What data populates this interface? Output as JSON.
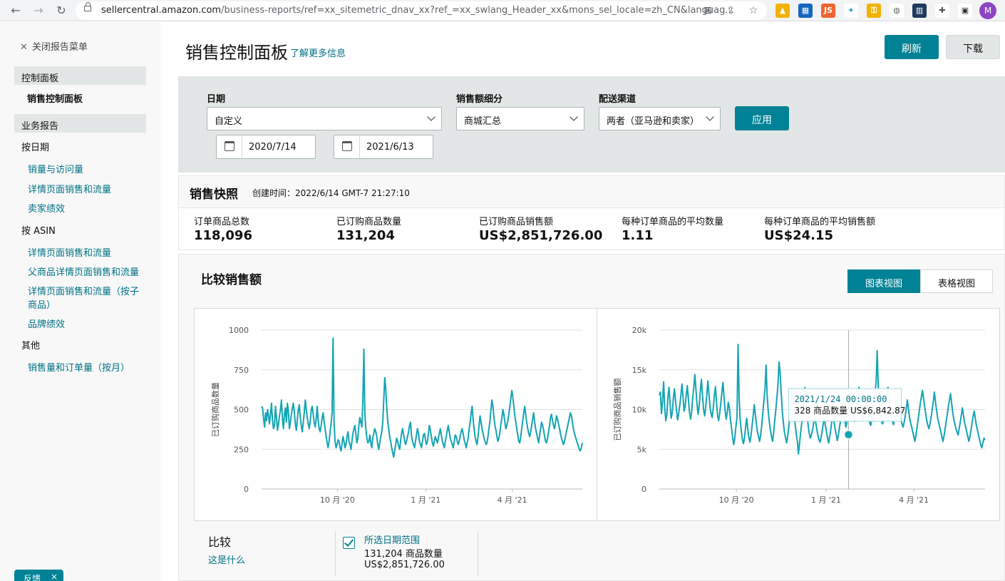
{
  "browser": {
    "url_host": "sellercentral.amazon.com",
    "url_path": "/business-reports/ref=xx_sitemetric_dnav_xx?ref_=xx_swlang_Header_xx&mons_sel_locale=zh_CN&languag...",
    "avatar_letter": "M",
    "nav_icons": [
      "back-icon",
      "forward-icon",
      "reload-icon"
    ]
  },
  "sidebar": {
    "close_label": "关闭报告菜单",
    "dashboard_section": "控制面板",
    "dashboard_active": "销售控制面板",
    "business_section": "业务报告",
    "by_date_group": "按日期",
    "by_date_items": [
      "销量与访问量",
      "详情页面销售和流量",
      "卖家绩效"
    ],
    "by_asin_group": "按 ASIN",
    "by_asin_items": [
      "详情页面销售和流量",
      "父商品详情页面销售和流量",
      "详情页面销售和流量（按子商品）",
      "品牌绩效"
    ],
    "other_group": "其他",
    "other_items": [
      "销售量和订单量（按月）"
    ],
    "feedback_label": "反馈",
    "feedback_close": "×"
  },
  "header": {
    "title": "销售控制面板",
    "learn_more": "了解更多信息",
    "refresh_label": "刷新",
    "download_label": "下载"
  },
  "filters": {
    "date_label": "日期",
    "date_value": "自定义",
    "start_date": "2020/7/14",
    "end_date": "2021/6/13",
    "breakdown_label": "销售额细分",
    "breakdown_value": "商城汇总",
    "channel_label": "配送渠道",
    "channel_value": "两者（亚马逊和卖家）",
    "apply_label": "应用"
  },
  "snapshot": {
    "title": "销售快照",
    "created": "创建时间：2022/6/14 GMT-7 21:27:10",
    "metrics": [
      {
        "label": "订单商品总数",
        "value": "118,096"
      },
      {
        "label": "已订购商品数量",
        "value": "131,204"
      },
      {
        "label": "已订购商品销售额",
        "value": "US$2,851,726.00"
      },
      {
        "label": "每种订单商品的平均数量",
        "value": "1.11"
      },
      {
        "label": "每种订单商品的平均销售额",
        "value": "US$24.15"
      }
    ]
  },
  "compare": {
    "title": "比较销售额",
    "chart_view_label": "图表视图",
    "table_view_label": "表格视图",
    "compare_label": "比较",
    "whats_this": "这是什么",
    "range_label": "所选日期范围",
    "range_units": "131,204 商品数量",
    "range_sales": "US$2,851,726.00"
  },
  "colors": {
    "accent": "#008296",
    "line": "#13a4b4",
    "link": "#007185"
  },
  "chart_data": [
    {
      "type": "line",
      "ylabel": "已订购商品数量",
      "y_ticks": [
        "0",
        "250",
        "500",
        "750",
        "1000"
      ],
      "ylim": [
        0,
        1000
      ],
      "x_ticks": [
        "10 月 '20",
        "1 月 '21",
        "4 月 '21"
      ],
      "x_tick_dates": [
        "2020-10-01",
        "2021-01-01",
        "2021-04-01"
      ],
      "x_start": "2020-07-14",
      "x_end": "2021-06-13",
      "series": [
        {
          "values": [
            520,
            510,
            440,
            390,
            480,
            430,
            500,
            460,
            410,
            470,
            540,
            430,
            380,
            400,
            520,
            450,
            370,
            410,
            460,
            500,
            560,
            440,
            380,
            470,
            510,
            420,
            540,
            490,
            380,
            420,
            470,
            510,
            540,
            480,
            410,
            370,
            440,
            500,
            530,
            450,
            400,
            360,
            420,
            480,
            560,
            500,
            450,
            410,
            380,
            430,
            500,
            520,
            470,
            420,
            390,
            440,
            520,
            430,
            380,
            360,
            400,
            450,
            480,
            420,
            380,
            330,
            290,
            260,
            300,
            360,
            410,
            480,
            950,
            420,
            300,
            260,
            280,
            310,
            300,
            260,
            240,
            280,
            330,
            300,
            260,
            280,
            330,
            360,
            300,
            280,
            250,
            300,
            350,
            380,
            400,
            340,
            290,
            320,
            400,
            450,
            420,
            390,
            560,
            880,
            470,
            380,
            320,
            290,
            300,
            340,
            290,
            260,
            320,
            350,
            380,
            360,
            330,
            280,
            250,
            290,
            330,
            360,
            420,
            560,
            700,
            640,
            520,
            430,
            380,
            330,
            300,
            260,
            230,
            200,
            240,
            280,
            320,
            300,
            270,
            250,
            300,
            350,
            380,
            340,
            310,
            280,
            300,
            330,
            360,
            400,
            420,
            330,
            300,
            280,
            260,
            300,
            340,
            380,
            350,
            300,
            280,
            260,
            300,
            340,
            350,
            310,
            280,
            300,
            350,
            400,
            370,
            330,
            290,
            270,
            300,
            330,
            310,
            290,
            320,
            350,
            380,
            340,
            300,
            280,
            260,
            300,
            330,
            370,
            400,
            360,
            320,
            300,
            280,
            260,
            300,
            340,
            330,
            300,
            280,
            300,
            330,
            360,
            380,
            350,
            310,
            290,
            260,
            290,
            320,
            380,
            420,
            480,
            520,
            440,
            380,
            330,
            300,
            280,
            330,
            400,
            460,
            420,
            380,
            350,
            320,
            300,
            280,
            290,
            330,
            380,
            430,
            500,
            560,
            520,
            450,
            400,
            370,
            330,
            300,
            320,
            360,
            410,
            450,
            500,
            470,
            420,
            380,
            400,
            430,
            470,
            520,
            570,
            620,
            580,
            520,
            460,
            420,
            380,
            340,
            300,
            290,
            330,
            380,
            430,
            480,
            520,
            470,
            420,
            380,
            350,
            330,
            360,
            400,
            440,
            480,
            420,
            380,
            350,
            320,
            290,
            340,
            380,
            420,
            400,
            370,
            330,
            300,
            290,
            320,
            360,
            400,
            450,
            470,
            430,
            400,
            380,
            420,
            460,
            440,
            410,
            380,
            350,
            320,
            300,
            280,
            300,
            330,
            360,
            390,
            420,
            450,
            480,
            460,
            420,
            380,
            350,
            330,
            310,
            290,
            270,
            250,
            240,
            260,
            290
          ]
        }
      ]
    },
    {
      "type": "line",
      "ylabel": "已订购商品销售额",
      "y_ticks": [
        "0",
        "5k",
        "10k",
        "15k",
        "20k"
      ],
      "ylim": [
        0,
        20000
      ],
      "x_ticks": [
        "10 月 '20",
        "1 月 '21",
        "4 月 '21"
      ],
      "x_tick_dates": [
        "2020-10-01",
        "2021-01-01",
        "2021-04-01"
      ],
      "x_start": "2020-07-14",
      "x_end": "2021-06-13",
      "tooltip": {
        "date": "2021/1/24 00:00:00",
        "text": "328 商品数量 US$6,842.87",
        "x": "2021-01-24",
        "y": 6842.87
      },
      "series": [
        {
          "values": [
            11800,
            12200,
            9500,
            11000,
            13500,
            10200,
            8600,
            9400,
            11600,
            12800,
            10800,
            8900,
            9600,
            11400,
            12600,
            11200,
            9800,
            8700,
            9500,
            10600,
            11800,
            13200,
            11600,
            9800,
            10400,
            11900,
            13000,
            11200,
            9600,
            8800,
            9700,
            11600,
            12800,
            14400,
            12400,
            10600,
            9400,
            10500,
            12300,
            13800,
            11900,
            10100,
            9200,
            10300,
            11800,
            13600,
            12000,
            10400,
            9500,
            9000,
            10200,
            11700,
            12900,
            11000,
            9300,
            8600,
            9500,
            10800,
            12200,
            13400,
            11600,
            9900,
            8800,
            9600,
            10900,
            10200,
            8700,
            7600,
            6500,
            5600,
            6400,
            7800,
            9000,
            18200,
            11400,
            8600,
            7400,
            6300,
            5700,
            6400,
            7800,
            8900,
            7600,
            6500,
            5900,
            6700,
            7900,
            9200,
            10600,
            9400,
            8200,
            7200,
            6600,
            6000,
            6800,
            8100,
            9600,
            11200,
            12600,
            15600,
            11800,
            9800,
            8400,
            7400,
            6600,
            6000,
            7100,
            8600,
            9900,
            11400,
            13200,
            16000,
            14600,
            12200,
            9800,
            8400,
            7200,
            6500,
            5800,
            6600,
            7800,
            9200,
            10800,
            12600,
            11400,
            9600,
            8100,
            6900,
            6000,
            4400,
            5700,
            7000,
            8200,
            9800,
            11100,
            12800,
            11200,
            9400,
            8000,
            7000,
            6400,
            6842,
            7400,
            8200,
            9000,
            8400,
            7600,
            6800,
            6200,
            5900,
            6500,
            7300,
            8200,
            9000,
            8000,
            7200,
            6400,
            5800,
            6600,
            7500,
            8600,
            9200,
            8400,
            7600,
            6800,
            6100,
            6800,
            7700,
            8600,
            9800,
            11600,
            9800,
            8600,
            7800,
            8400,
            9300,
            10600,
            12000,
            11000,
            9900,
            9000,
            8500,
            9200,
            10100,
            11600,
            12800,
            11200,
            9800,
            9000,
            8600,
            9200,
            10400,
            11600,
            10400,
            9200,
            8400,
            8000,
            8800,
            9900,
            11000,
            12200,
            13400,
            17400,
            12800,
            10800,
            9400,
            8600,
            8200,
            8600,
            9400,
            10400,
            11600,
            12800,
            11400,
            10200,
            9200,
            8600,
            8100,
            8800,
            9800,
            11000,
            12000,
            10800,
            9600,
            8700,
            8200,
            7800,
            8400,
            9200,
            10200,
            11200,
            10000,
            9000,
            8300,
            7800,
            7200,
            6600,
            6000,
            6800,
            7800,
            8800,
            9800,
            10800,
            11600,
            12400,
            11400,
            10400,
            9400,
            8600,
            8000,
            7600,
            8200,
            9000,
            10000,
            11000,
            12200,
            11000,
            10000,
            9000,
            8400,
            7800,
            7200,
            6600,
            6000,
            6700,
            7600,
            8500,
            9400,
            10400,
            11200,
            12000,
            10800,
            9700,
            8800,
            8200,
            7600,
            7200,
            6800,
            7600,
            8400,
            9300,
            10200,
            9300,
            8400,
            7800,
            7200,
            6600,
            6000,
            6600,
            7400,
            8300,
            9200,
            9800,
            8800,
            8000,
            7400,
            6800,
            6200,
            5600,
            5200,
            5800,
            6400,
            6200
          ]
        }
      ]
    }
  ]
}
